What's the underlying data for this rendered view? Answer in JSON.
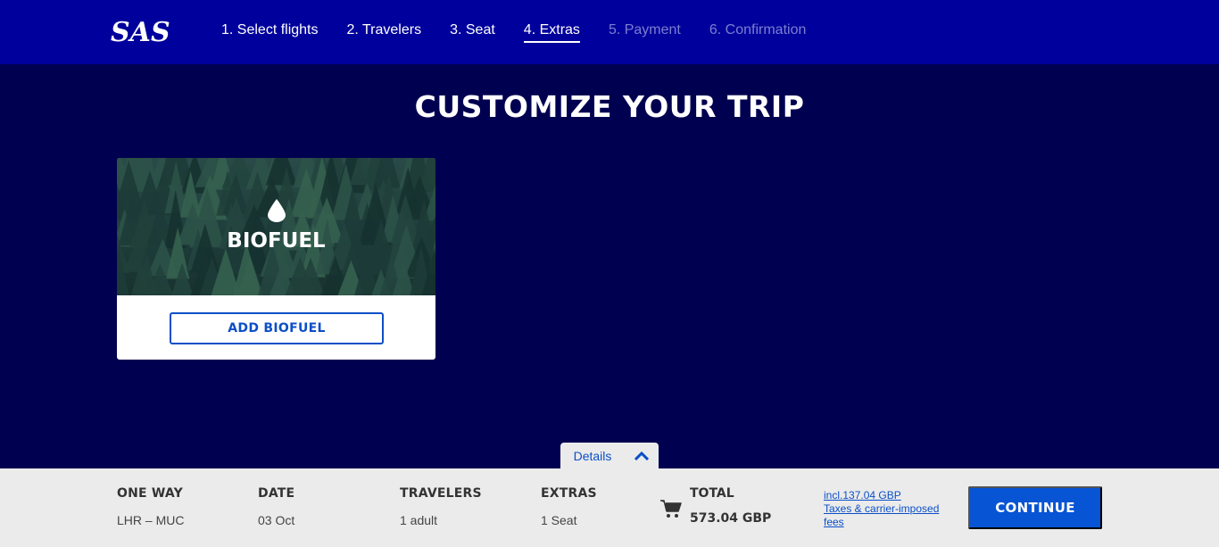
{
  "header": {
    "logo_text": "SAS",
    "steps": [
      {
        "label": "1. Select flights",
        "state": "done"
      },
      {
        "label": "2. Travelers",
        "state": "done"
      },
      {
        "label": "3. Seat",
        "state": "done"
      },
      {
        "label": "4. Extras",
        "state": "active"
      },
      {
        "label": "5. Payment",
        "state": "disabled"
      },
      {
        "label": "6. Confirmation",
        "state": "disabled"
      }
    ]
  },
  "main": {
    "title": "CUSTOMIZE YOUR TRIP",
    "cards": [
      {
        "title": "BIOFUEL",
        "icon": "drop-icon",
        "button_label": "ADD BIOFUEL"
      }
    ]
  },
  "details_tab": {
    "label": "Details",
    "icon": "chevron-up-icon"
  },
  "footer": {
    "trip_type": {
      "head": "ONE WAY",
      "value": "LHR – MUC"
    },
    "date": {
      "head": "DATE",
      "value": "03 Oct"
    },
    "travelers": {
      "head": "TRAVELERS",
      "value": "1 adult"
    },
    "extras": {
      "head": "EXTRAS",
      "value": "1 Seat"
    },
    "total": {
      "head": "TOTAL",
      "value": "573.04 GBP",
      "icon": "cart-icon"
    },
    "taxes_line1": "incl.137.04 GBP",
    "taxes_line2": "Taxes & carrier-imposed",
    "taxes_line3": "fees",
    "continue_label": "CONTINUE"
  },
  "colors": {
    "topbar": "#00009c",
    "background": "#000050",
    "accent": "#0754d4",
    "footer_bg": "#ebebeb"
  }
}
